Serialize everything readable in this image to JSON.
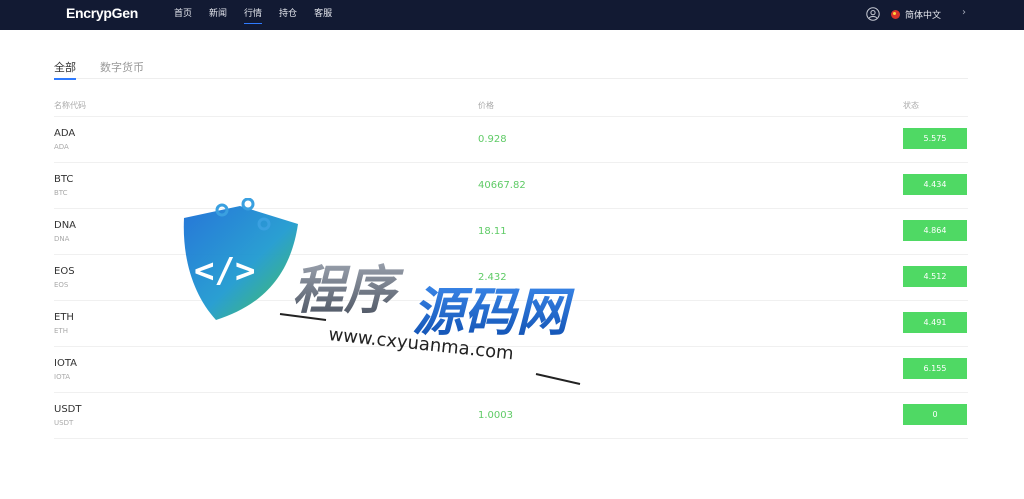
{
  "header": {
    "logo": "EncrypGen",
    "nav": [
      "首页",
      "新闻",
      "行情",
      "持仓",
      "客服"
    ],
    "active_nav_index": 2,
    "language": "简体中文",
    "user_icon": "user-circle-icon",
    "expand_icon": "chevron-right-icon"
  },
  "tabs": {
    "all": "全部",
    "digital": "数字货币"
  },
  "table": {
    "col_name": "名称代码",
    "col_price": "价格",
    "col_status": "状态"
  },
  "rows": [
    {
      "symbol": "ADA",
      "code": "ADA",
      "price": "0.928",
      "status": "5.575"
    },
    {
      "symbol": "BTC",
      "code": "BTC",
      "price": "40667.82",
      "status": "4.434"
    },
    {
      "symbol": "DNA",
      "code": "DNA",
      "price": "18.11",
      "status": "4.864"
    },
    {
      "symbol": "EOS",
      "code": "EOS",
      "price": "2.432",
      "status": "4.512"
    },
    {
      "symbol": "ETH",
      "code": "ETH",
      "price": "",
      "status": "4.491"
    },
    {
      "symbol": "IOTA",
      "code": "IOTA",
      "price": "",
      "status": "6.155"
    },
    {
      "symbol": "USDT",
      "code": "USDT",
      "price": "1.0003",
      "status": "0"
    }
  ],
  "colors": {
    "topbar": "#121a33",
    "accent": "#2f7bff",
    "price_green": "#5fcb66",
    "badge_green": "#4fd964"
  },
  "watermark": {
    "title": "程序源码网",
    "url": "www.cxyuanma.com",
    "logo_icon": "code-shield-icon"
  }
}
